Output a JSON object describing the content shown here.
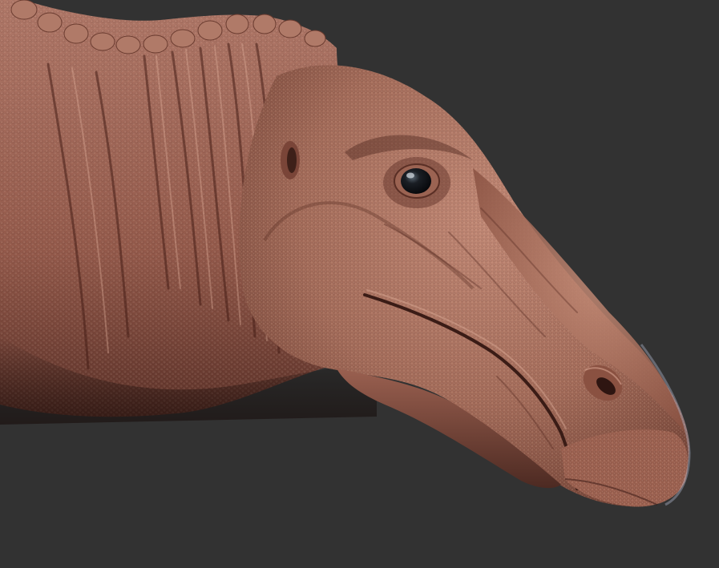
{
  "scene": {
    "subject": "hadrosaur-head-sculpt",
    "colors": {
      "background": "#323232",
      "skin_base": "#a9705e",
      "skin_light": "#c9917c",
      "skin_shadow": "#6e3f33",
      "skin_deep": "#4a2820",
      "eye": "#0d0f12",
      "eye_highlight": "#cfd6dc"
    }
  }
}
